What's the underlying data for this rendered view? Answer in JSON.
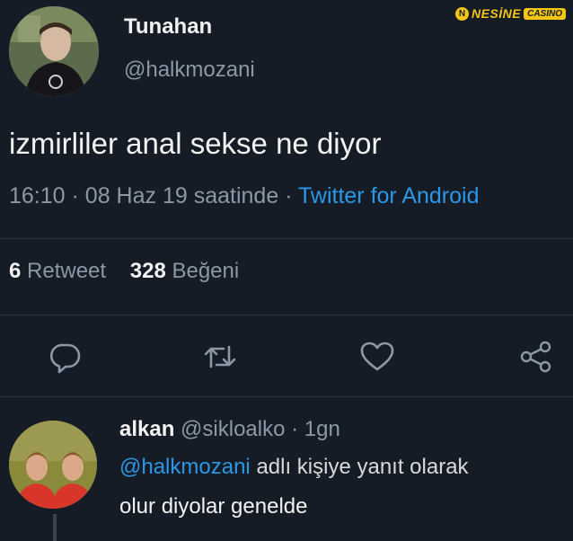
{
  "watermark": {
    "brand": "NESİNE",
    "sub": "CASINO",
    "coin": "N"
  },
  "tweet": {
    "display_name": "Tunahan",
    "handle": "@halkmozani",
    "text": "izmirliler anal sekse ne diyor",
    "time": "16:10",
    "date": "08 Haz 19 saatinde",
    "source": "Twitter for Android",
    "retweet_count": "6",
    "retweet_label": "Retweet",
    "like_count": "328",
    "like_label": "Beğeni"
  },
  "actions": [
    {
      "icon": "reply-icon"
    },
    {
      "icon": "retweet-icon"
    },
    {
      "icon": "heart-icon"
    },
    {
      "icon": "share-icon"
    }
  ],
  "reply": {
    "display_name": "alkan",
    "handle": "@sikloalko",
    "time": "1gn",
    "replying_mention": "@halkmozani",
    "replying_suffix": "adlı kişiye yanıt olarak",
    "text": "olur diyolar genelde"
  },
  "colors": {
    "background": "#151c26",
    "accent": "#2b97e6",
    "muted": "#8b98a5",
    "watermark": "#f5c518"
  }
}
